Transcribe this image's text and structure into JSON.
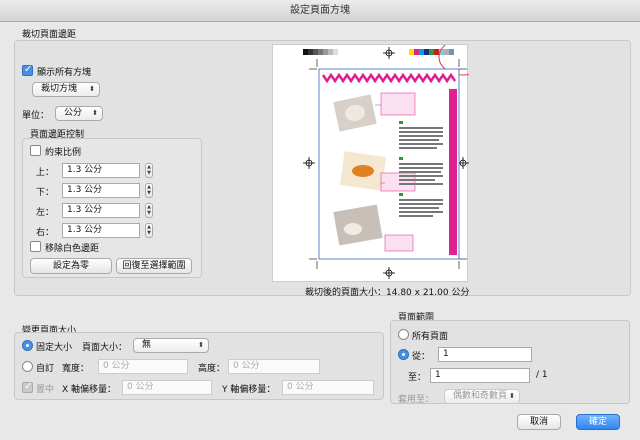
{
  "window": {
    "title": "設定頁面方塊"
  },
  "crop": {
    "group_title": "裁切頁面邊距",
    "show_all_boxes": "顯示所有方塊",
    "box_type": "裁切方塊",
    "unit_label": "單位：",
    "unit_value": "公分",
    "margin_control_title": "頁面邊距控制",
    "constrain_proportions": "約束比例",
    "top_label": "上：",
    "top_value": "1.3 公分",
    "bottom_label": "下：",
    "bottom_value": "1.3 公分",
    "left_label": "左：",
    "left_value": "1.3 公分",
    "right_label": "右：",
    "right_value": "1.3 公分",
    "remove_white_margins": "移除白色邊距",
    "set_to_zero": "設定為零",
    "revert_to_selection": "回復至選擇範圍"
  },
  "preview": {
    "size_text": "裁切後的頁面大小：14.80 x 21.00 公分"
  },
  "change_size": {
    "group_title": "變更頁面大小",
    "fixed_size": "固定大小",
    "page_size_label": "頁面大小：",
    "page_size_value": "無",
    "custom": "自訂",
    "width_label": "寬度：",
    "width_value": "0 公分",
    "height_label": "高度：",
    "height_value": "0 公分",
    "center": "置中",
    "x_offset_label": "X 軸偏移量：",
    "x_offset_value": "0 公分",
    "y_offset_label": "Y 軸偏移量：",
    "y_offset_value": "0 公分"
  },
  "page_range": {
    "group_title": "頁面範圍",
    "all_pages": "所有頁面",
    "from_label": "從：",
    "from_value": "1",
    "to_label": "至：",
    "to_value": "1",
    "total": "/ 1",
    "apply_to_label": "套用至：",
    "apply_to_value": "偶數和奇數頁"
  },
  "buttons": {
    "cancel": "取消",
    "ok": "確定"
  },
  "colors": {
    "accent": "#4a90e2",
    "magenta": "#e0208f"
  }
}
